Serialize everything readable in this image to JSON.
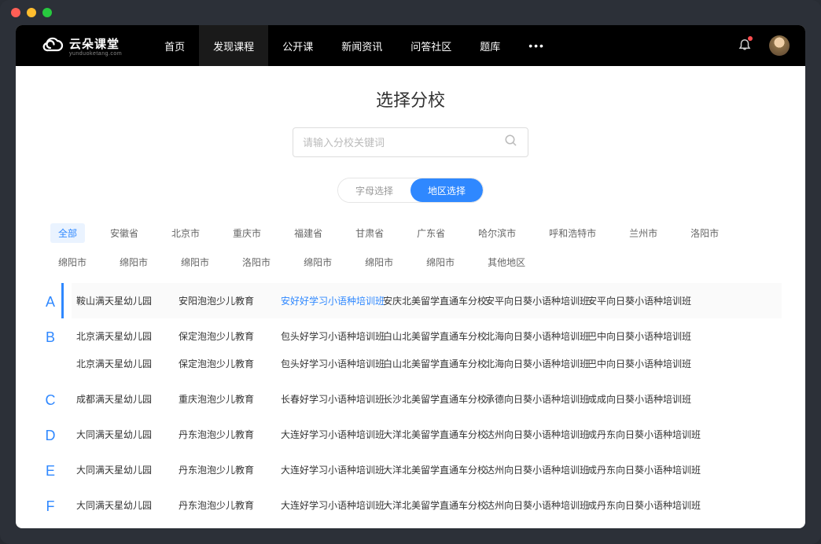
{
  "brand": {
    "name": "云朵课堂",
    "sub": "yunduoketang.com"
  },
  "nav": {
    "items": [
      "首页",
      "发现课程",
      "公开课",
      "新闻资讯",
      "问答社区",
      "题库"
    ],
    "activeIndex": 1
  },
  "page": {
    "title": "选择分校",
    "searchPlaceholder": "请输入分校关键词"
  },
  "toggle": {
    "options": [
      "字母选择",
      "地区选择"
    ],
    "activeIndex": 1
  },
  "regions": {
    "active": "全部",
    "items": [
      "全部",
      "安徽省",
      "北京市",
      "重庆市",
      "福建省",
      "甘肃省",
      "广东省",
      "哈尔滨市",
      "呼和浩特市",
      "兰州市",
      "洛阳市",
      "绵阳市",
      "绵阳市",
      "绵阳市",
      "洛阳市",
      "绵阳市",
      "绵阳市",
      "绵阳市",
      "其他地区"
    ]
  },
  "sections": [
    {
      "letter": "A",
      "highlighted": true,
      "rows": [
        [
          {
            "name": "鞍山满天星幼儿园"
          },
          {
            "name": "安阳泡泡少儿教育"
          },
          {
            "name": "安好好学习小语种培训班",
            "highlight": true
          },
          {
            "name": "安庆北美留学直通车分校"
          },
          {
            "name": "安平向日葵小语种培训班"
          },
          {
            "name": "安平向日葵小语种培训班"
          }
        ]
      ]
    },
    {
      "letter": "B",
      "rows": [
        [
          {
            "name": "北京满天星幼儿园"
          },
          {
            "name": "保定泡泡少儿教育"
          },
          {
            "name": "包头好学习小语种培训班"
          },
          {
            "name": "白山北美留学直通车分校"
          },
          {
            "name": "北海向日葵小语种培训班"
          },
          {
            "name": "巴中向日葵小语种培训班"
          }
        ],
        [
          {
            "name": "北京满天星幼儿园"
          },
          {
            "name": "保定泡泡少儿教育"
          },
          {
            "name": "包头好学习小语种培训班"
          },
          {
            "name": "白山北美留学直通车分校"
          },
          {
            "name": "北海向日葵小语种培训班"
          },
          {
            "name": "巴中向日葵小语种培训班"
          }
        ]
      ]
    },
    {
      "letter": "C",
      "rows": [
        [
          {
            "name": "成都满天星幼儿园"
          },
          {
            "name": "重庆泡泡少儿教育"
          },
          {
            "name": "长春好学习小语种培训班"
          },
          {
            "name": "长沙北美留学直通车分校"
          },
          {
            "name": "承德向日葵小语种培训班"
          },
          {
            "name": "成成向日葵小语种培训班"
          }
        ]
      ]
    },
    {
      "letter": "D",
      "rows": [
        [
          {
            "name": "大同满天星幼儿园"
          },
          {
            "name": "丹东泡泡少儿教育"
          },
          {
            "name": "大连好学习小语种培训班"
          },
          {
            "name": "大洋北美留学直通车分校"
          },
          {
            "name": "达州向日葵小语种培训班"
          },
          {
            "name": "成丹东向日葵小语种培训班"
          }
        ]
      ]
    },
    {
      "letter": "E",
      "rows": [
        [
          {
            "name": "大同满天星幼儿园"
          },
          {
            "name": "丹东泡泡少儿教育"
          },
          {
            "name": "大连好学习小语种培训班"
          },
          {
            "name": "大洋北美留学直通车分校"
          },
          {
            "name": "达州向日葵小语种培训班"
          },
          {
            "name": "成丹东向日葵小语种培训班"
          }
        ]
      ]
    },
    {
      "letter": "F",
      "rows": [
        [
          {
            "name": "大同满天星幼儿园"
          },
          {
            "name": "丹东泡泡少儿教育"
          },
          {
            "name": "大连好学习小语种培训班"
          },
          {
            "name": "大洋北美留学直通车分校"
          },
          {
            "name": "达州向日葵小语种培训班"
          },
          {
            "name": "成丹东向日葵小语种培训班"
          }
        ]
      ]
    }
  ]
}
